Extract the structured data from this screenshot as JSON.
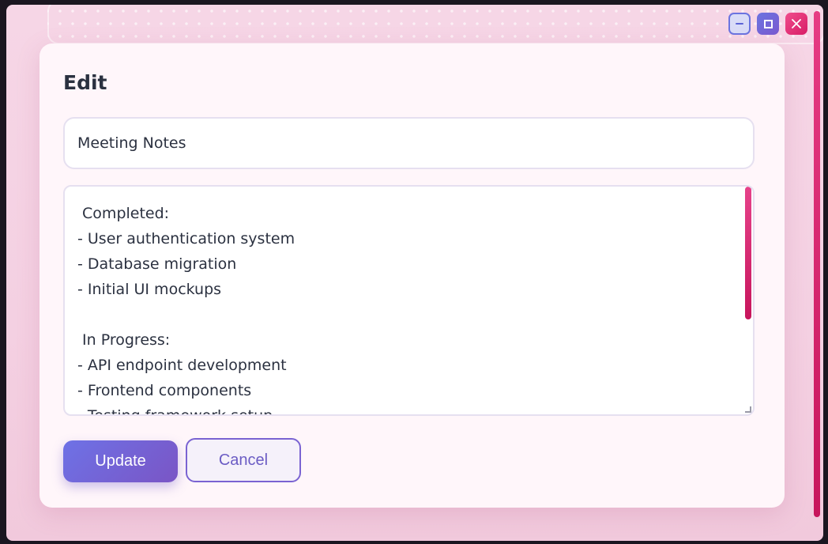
{
  "dialog": {
    "title": "Edit",
    "title_value": "Meeting Notes",
    "body_lines": [
      " Completed:",
      "- User authentication system",
      "- Database migration",
      "- Initial UI mockups",
      "",
      " In Progress:",
      "- API endpoint development",
      "- Frontend components",
      "- Testing framework setup"
    ],
    "update_label": "Update",
    "cancel_label": "Cancel"
  },
  "window_controls": {
    "minimize_icon": "minimize-icon",
    "maximize_icon": "maximize-icon",
    "close_icon": "close-icon"
  },
  "colors": {
    "accent": "#6e72e6",
    "accent_pink": "#e6428a",
    "background": "#f6d6e6"
  }
}
